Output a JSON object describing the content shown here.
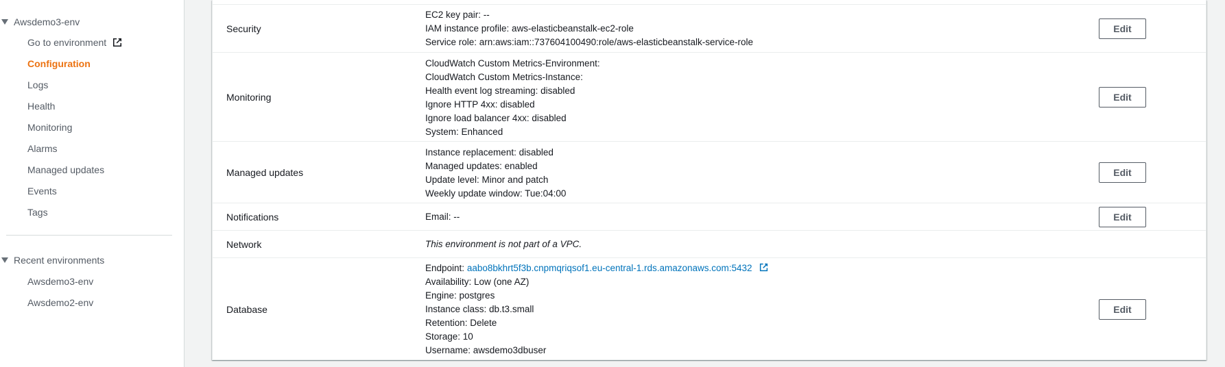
{
  "sidebar": {
    "env_name": "Awsdemo3-env",
    "items": [
      {
        "label": "Go to environment"
      },
      {
        "label": "Configuration"
      },
      {
        "label": "Logs"
      },
      {
        "label": "Health"
      },
      {
        "label": "Monitoring"
      },
      {
        "label": "Alarms"
      },
      {
        "label": "Managed updates"
      },
      {
        "label": "Events"
      },
      {
        "label": "Tags"
      }
    ],
    "recent_title": "Recent environments",
    "recent": [
      {
        "label": "Awsdemo3-env"
      },
      {
        "label": "Awsdemo2-env"
      }
    ]
  },
  "config": {
    "edit_label": "Edit",
    "rows": [
      {
        "label": "Security",
        "values": [
          "EC2 key pair: --",
          "IAM instance profile: aws-elasticbeanstalk-ec2-role",
          "Service role: arn:aws:iam::737604100490:role/aws-elasticbeanstalk-service-role"
        ]
      },
      {
        "label": "Monitoring",
        "values": [
          "CloudWatch Custom Metrics-Environment:",
          "CloudWatch Custom Metrics-Instance:",
          "Health event log streaming: disabled",
          "Ignore HTTP 4xx: disabled",
          "Ignore load balancer 4xx: disabled",
          "System: Enhanced"
        ]
      },
      {
        "label": "Managed updates",
        "values": [
          "Instance replacement: disabled",
          "Managed updates: enabled",
          "Update level: Minor and patch",
          "Weekly update window: Tue:04:00"
        ]
      },
      {
        "label": "Notifications",
        "values": [
          "Email: --"
        ]
      },
      {
        "label": "Network",
        "values": [
          "This environment is not part of a VPC."
        ]
      },
      {
        "label": "Database",
        "endpoint_label": "Endpoint:",
        "endpoint_link": "aabo8bkhrt5f3b.cnpmqriqsof1.eu-central-1.rds.amazonaws.com:5432",
        "values": [
          "Availability: Low (one AZ)",
          "Engine: postgres",
          "Instance class: db.t3.small",
          "Retention: Delete",
          "Storage: 10",
          "Username: awsdemo3dbuser"
        ]
      }
    ]
  },
  "colors": {
    "accent_active": "#ec7211",
    "link": "#0073bb",
    "nav_text": "#545b64"
  }
}
